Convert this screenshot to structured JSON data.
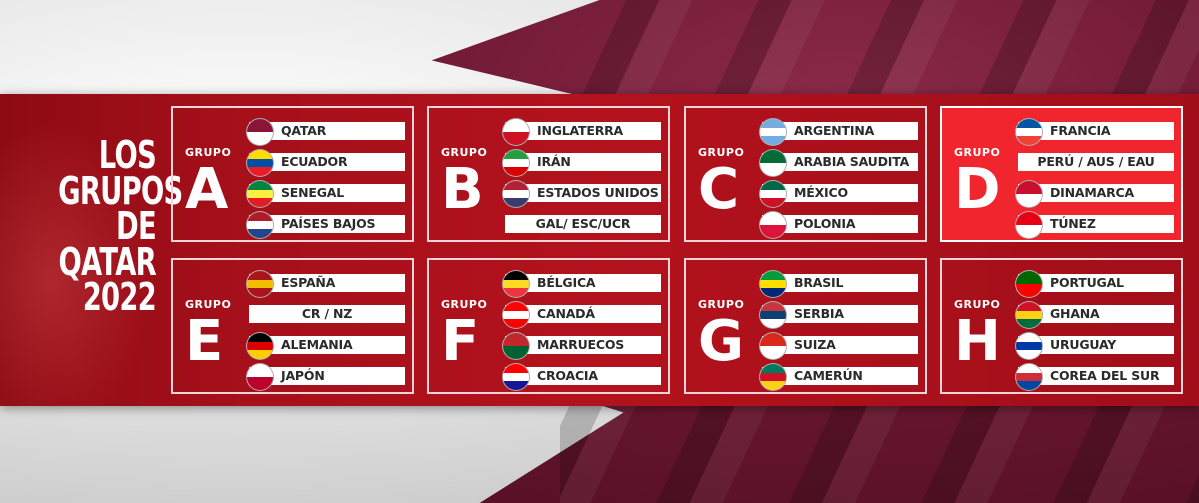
{
  "headline": [
    "LOS",
    "GRUPOS",
    "DE",
    "QATAR",
    "2022"
  ],
  "group_word": "GRUPO",
  "groups": [
    {
      "letter": "A",
      "highlight": false,
      "teams": [
        {
          "name": "QATAR",
          "flag": "qatar-flag-icon",
          "colors": [
            "#8a1538",
            "#ffffff"
          ]
        },
        {
          "name": "ECUADOR",
          "flag": "ecuador-flag-icon",
          "colors": [
            "#ffdd00",
            "#034ea2",
            "#ed1c24"
          ]
        },
        {
          "name": "SENEGAL",
          "flag": "senegal-flag-icon",
          "colors": [
            "#00853f",
            "#fdef42",
            "#e31b23"
          ]
        },
        {
          "name": "PAÍSES BAJOS",
          "flag": "netherlands-flag-icon",
          "colors": [
            "#ae1c28",
            "#ffffff",
            "#21468b"
          ]
        }
      ]
    },
    {
      "letter": "B",
      "highlight": false,
      "teams": [
        {
          "name": "INGLATERRA",
          "flag": "england-flag-icon",
          "colors": [
            "#ffffff",
            "#ce1124"
          ]
        },
        {
          "name": "IRÁN",
          "flag": "iran-flag-icon",
          "colors": [
            "#239f40",
            "#ffffff",
            "#da0000"
          ]
        },
        {
          "name": "ESTADOS UNIDOS",
          "flag": "usa-flag-icon",
          "colors": [
            "#b22234",
            "#ffffff",
            "#3c3b6e"
          ]
        },
        {
          "name": "GAL/ ESC/UCR",
          "tbd": true
        }
      ]
    },
    {
      "letter": "C",
      "highlight": false,
      "teams": [
        {
          "name": "ARGENTINA",
          "flag": "argentina-flag-icon",
          "colors": [
            "#74acdf",
            "#ffffff",
            "#74acdf"
          ]
        },
        {
          "name": "ARABIA SAUDITA",
          "flag": "saudi-arabia-flag-icon",
          "colors": [
            "#006c35",
            "#ffffff"
          ]
        },
        {
          "name": "MÉXICO",
          "flag": "mexico-flag-icon",
          "colors": [
            "#006847",
            "#ffffff",
            "#ce1126"
          ]
        },
        {
          "name": "POLONIA",
          "flag": "poland-flag-icon",
          "colors": [
            "#ffffff",
            "#dc143c"
          ]
        }
      ]
    },
    {
      "letter": "D",
      "highlight": true,
      "teams": [
        {
          "name": "FRANCIA",
          "flag": "france-flag-icon",
          "colors": [
            "#0055a4",
            "#ffffff",
            "#ef4135"
          ]
        },
        {
          "name": "PERÚ / AUS / EAU",
          "tbd": true
        },
        {
          "name": "DINAMARCA",
          "flag": "denmark-flag-icon",
          "colors": [
            "#c8102e",
            "#ffffff"
          ]
        },
        {
          "name": "TÚNEZ",
          "flag": "tunisia-flag-icon",
          "colors": [
            "#e70013",
            "#ffffff"
          ]
        }
      ]
    },
    {
      "letter": "E",
      "highlight": false,
      "teams": [
        {
          "name": "ESPAÑA",
          "flag": "spain-flag-icon",
          "colors": [
            "#aa151b",
            "#f1bf00",
            "#aa151b"
          ]
        },
        {
          "name": "CR / NZ",
          "tbd": true
        },
        {
          "name": "ALEMANIA",
          "flag": "germany-flag-icon",
          "colors": [
            "#000000",
            "#dd0000",
            "#ffce00"
          ]
        },
        {
          "name": "JAPÓN",
          "flag": "japan-flag-icon",
          "colors": [
            "#ffffff",
            "#bc002d"
          ]
        }
      ]
    },
    {
      "letter": "F",
      "highlight": false,
      "teams": [
        {
          "name": "BÉLGICA",
          "flag": "belgium-flag-icon",
          "colors": [
            "#000000",
            "#fdda24",
            "#ef3340"
          ]
        },
        {
          "name": "CANADÁ",
          "flag": "canada-flag-icon",
          "colors": [
            "#ff0000",
            "#ffffff",
            "#ff0000"
          ]
        },
        {
          "name": "MARRUECOS",
          "flag": "morocco-flag-icon",
          "colors": [
            "#c1272d",
            "#006233"
          ]
        },
        {
          "name": "CROACIA",
          "flag": "croatia-flag-icon",
          "colors": [
            "#ff0000",
            "#ffffff",
            "#171796"
          ]
        }
      ]
    },
    {
      "letter": "G",
      "highlight": false,
      "teams": [
        {
          "name": "BRASIL",
          "flag": "brazil-flag-icon",
          "colors": [
            "#009c3b",
            "#ffdf00",
            "#002776"
          ]
        },
        {
          "name": "SERBIA",
          "flag": "serbia-flag-icon",
          "colors": [
            "#c6363c",
            "#0c4076",
            "#ffffff"
          ]
        },
        {
          "name": "SUIZA",
          "flag": "switzerland-flag-icon",
          "colors": [
            "#da291c",
            "#ffffff"
          ]
        },
        {
          "name": "CAMERÚN",
          "flag": "cameroon-flag-icon",
          "colors": [
            "#007a5e",
            "#ce1126",
            "#fcd116"
          ]
        }
      ]
    },
    {
      "letter": "H",
      "highlight": false,
      "teams": [
        {
          "name": "PORTUGAL",
          "flag": "portugal-flag-icon",
          "colors": [
            "#006600",
            "#ff0000"
          ]
        },
        {
          "name": "GHANA",
          "flag": "ghana-flag-icon",
          "colors": [
            "#ce1126",
            "#fcd116",
            "#006b3f"
          ]
        },
        {
          "name": "URUGUAY",
          "flag": "uruguay-flag-icon",
          "colors": [
            "#ffffff",
            "#0038a8",
            "#ffffff"
          ]
        },
        {
          "name": "COREA DEL SUR",
          "flag": "south-korea-flag-icon",
          "colors": [
            "#ffffff",
            "#cd2e3a",
            "#0047a0"
          ]
        }
      ]
    }
  ]
}
